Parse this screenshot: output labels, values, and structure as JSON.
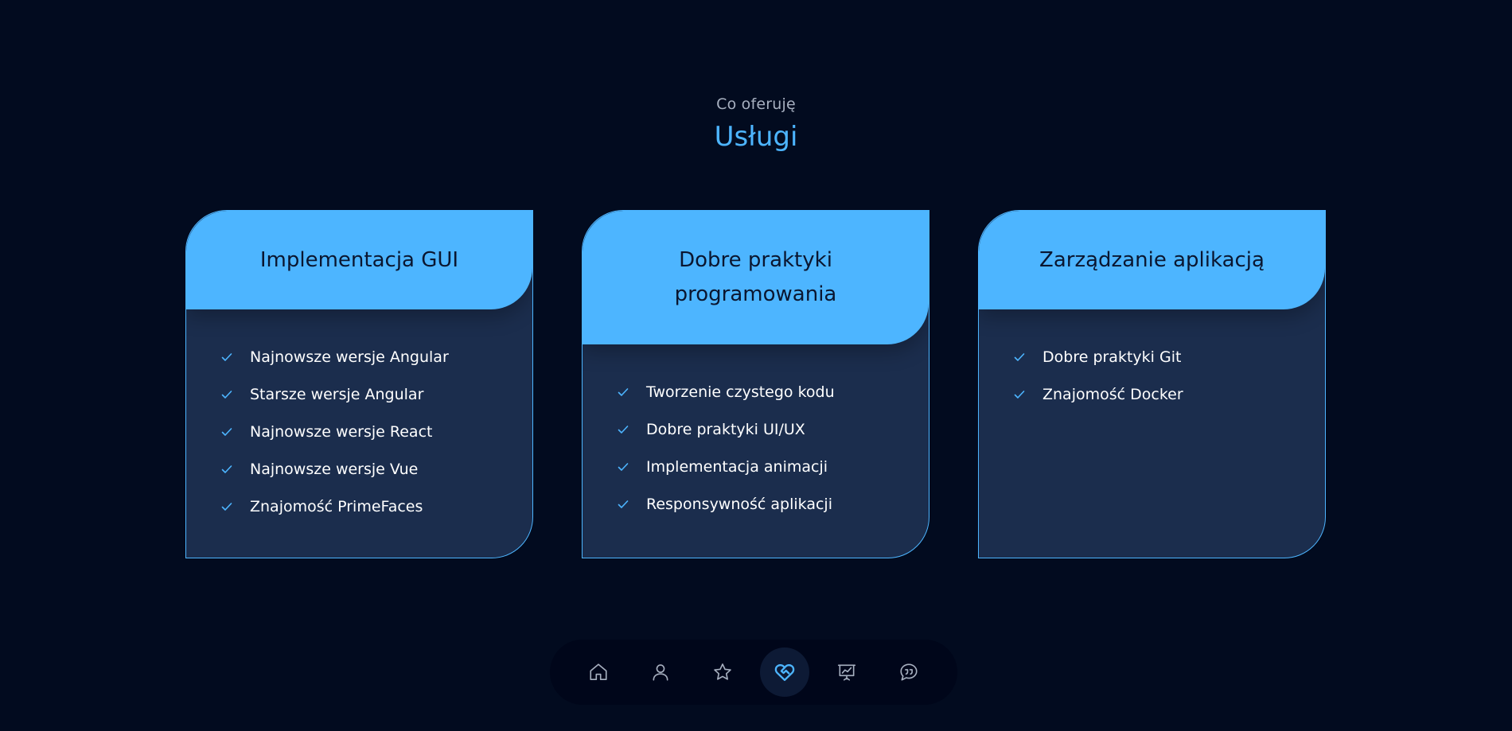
{
  "header": {
    "subtitle": "Co oferuję",
    "title": "Usługi"
  },
  "colors": {
    "background": "#020b1f",
    "accent": "#4db5ff",
    "card_body": "#1b2d4d",
    "dock": "#00061a"
  },
  "cards": [
    {
      "title": "Implementacja GUI",
      "items": [
        "Najnowsze wersje Angular",
        "Starsze wersje Angular",
        "Najnowsze wersje React",
        "Najnowsze wersje Vue",
        "Znajomość PrimeFaces"
      ]
    },
    {
      "title": "Dobre praktyki programowania",
      "items": [
        "Tworzenie czystego kodu",
        "Dobre praktyki UI/UX",
        "Implementacja animacji",
        "Responsywność aplikacji"
      ]
    },
    {
      "title": "Zarządzanie aplikacją",
      "items": [
        "Dobre praktyki Git",
        "Znajomość Docker"
      ]
    }
  ],
  "dock": {
    "items": [
      {
        "icon": "home-icon",
        "active": false
      },
      {
        "icon": "user-icon",
        "active": false
      },
      {
        "icon": "star-icon",
        "active": false
      },
      {
        "icon": "heart-handshake-icon",
        "active": true
      },
      {
        "icon": "presentation-chart-icon",
        "active": false
      },
      {
        "icon": "chat-quote-icon",
        "active": false
      }
    ]
  }
}
